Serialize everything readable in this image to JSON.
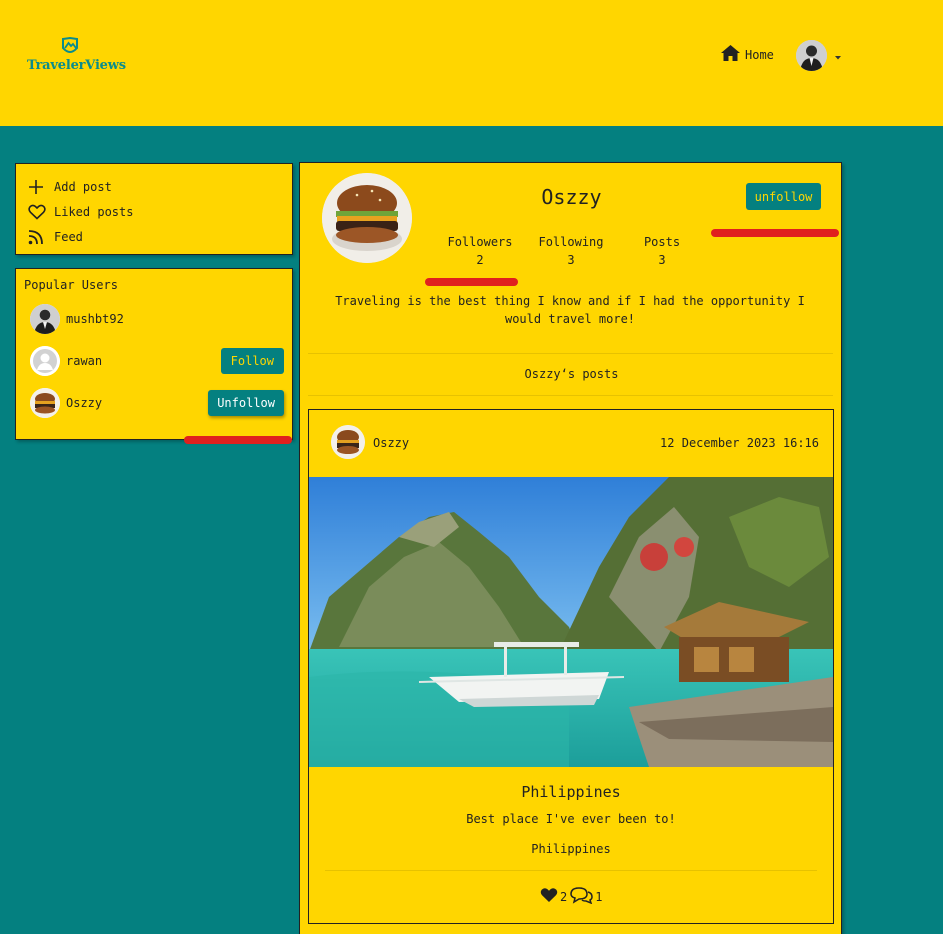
{
  "brand": {
    "name": "TravelerViews"
  },
  "nav": {
    "home_label": "Home"
  },
  "sidebar": {
    "menu": [
      {
        "label": "Add post",
        "icon": "plus-icon"
      },
      {
        "label": "Liked posts",
        "icon": "heart-outline-icon"
      },
      {
        "label": "Feed",
        "icon": "rss-icon"
      }
    ],
    "popular_title": "Popular Users",
    "popular_users": [
      {
        "name": "mushbt92",
        "action": ""
      },
      {
        "name": "rawan",
        "action": "Follow"
      },
      {
        "name": "Oszzy",
        "action": "Unfollow"
      }
    ]
  },
  "profile": {
    "name": "Oszzy",
    "unfollow_label": "unfollow",
    "stats": [
      {
        "label": "Followers",
        "value": "2"
      },
      {
        "label": "Following",
        "value": "3"
      },
      {
        "label": "Posts",
        "value": "3"
      }
    ],
    "bio": "Traveling is the best thing I know and if I had the opportunity I would travel more!",
    "posts_heading": "Oszzy‘s posts"
  },
  "post": {
    "user": "Oszzy",
    "date": "12 December 2023 16:16",
    "title": "Philippines",
    "description": "Best place I've ever been to!",
    "location": "Philippines",
    "likes": "2",
    "comments": "1"
  },
  "colors": {
    "primary": "#ffd600",
    "accent": "#048080",
    "highlight": "#e0201e"
  }
}
